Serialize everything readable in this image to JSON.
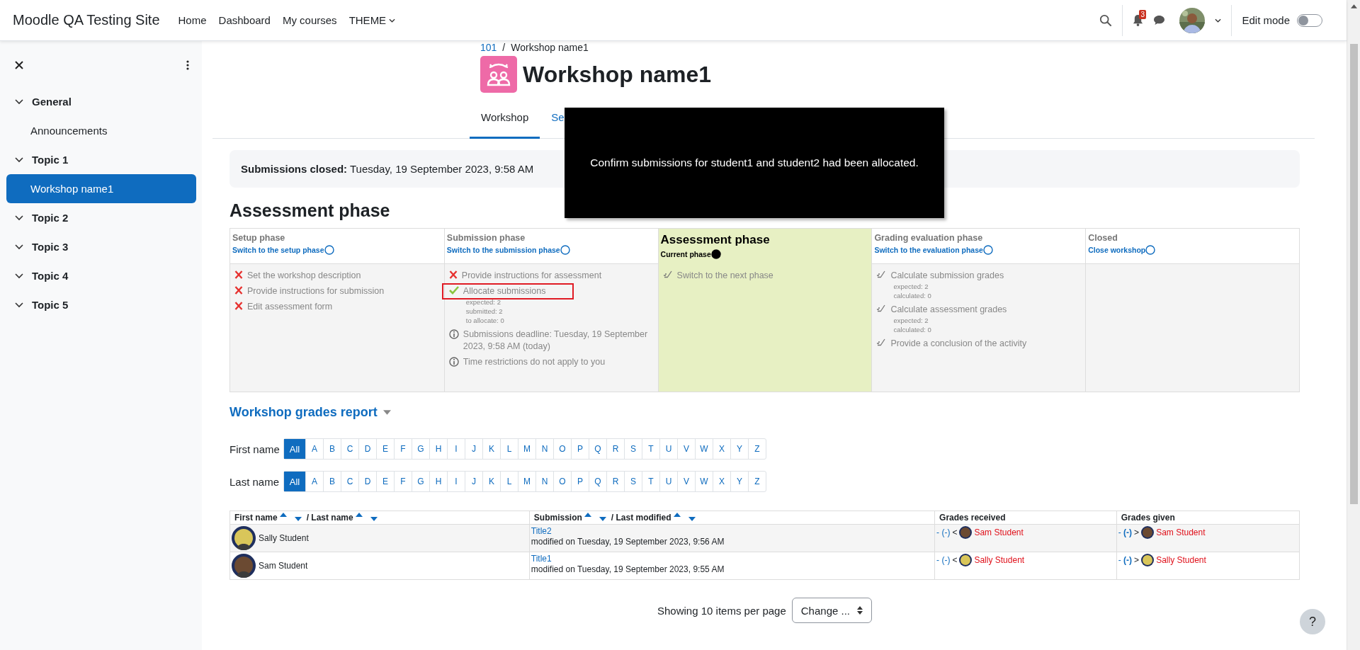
{
  "header": {
    "site_name": "Moodle QA Testing Site",
    "nav": [
      {
        "label": "Home",
        "menu": false
      },
      {
        "label": "Dashboard",
        "menu": false
      },
      {
        "label": "My courses",
        "menu": false
      },
      {
        "label": "THEME",
        "menu": true
      }
    ],
    "notification_count": "3",
    "edit_mode": {
      "label": "Edit mode",
      "on": false
    }
  },
  "sidebar": {
    "items": [
      {
        "label": "General",
        "expanded": true,
        "children": [
          {
            "label": "Announcements",
            "selected": false
          }
        ]
      },
      {
        "label": "Topic 1",
        "expanded": true,
        "children": [
          {
            "label": "Workshop name1",
            "selected": true
          }
        ]
      },
      {
        "label": "Topic 2",
        "expanded": true
      },
      {
        "label": "Topic 3",
        "expanded": true
      },
      {
        "label": "Topic 4",
        "expanded": true
      },
      {
        "label": "Topic 5",
        "expanded": true
      }
    ]
  },
  "breadcrumb": {
    "items": [
      "101",
      "Workshop name1"
    ],
    "separator": "/"
  },
  "title": "Workshop name1",
  "tabs": [
    {
      "label": "Workshop",
      "selected": true
    },
    {
      "label": "Se",
      "selected": false
    }
  ],
  "overlay": {
    "text": "Confirm submissions for student1 and student2 had been allocated."
  },
  "notice": "**Submissions closed:** Tuesday, 19 September 2023, 9:58 AM",
  "phase_heading": "Assessment phase",
  "phases": [
    {
      "name": "Setup phase",
      "link": "Switch to the setup phase",
      "current": false,
      "tasks": [
        {
          "kind": "fail",
          "label": "Set the workshop description"
        },
        {
          "kind": "fail",
          "label": "Provide instructions for submission"
        },
        {
          "kind": "fail",
          "label": "Edit assessment form"
        }
      ]
    },
    {
      "name": "Submission phase",
      "link": "Switch to the submission phase",
      "current": false,
      "tasks": [
        {
          "kind": "fail",
          "label": "Provide instructions for assessment"
        },
        {
          "kind": "done",
          "label": "Allocate submissions",
          "details": [
            "expected: 2",
            "submitted: 2",
            "to allocate: 0"
          ],
          "highlighted": true
        },
        {
          "kind": "info",
          "label": "Submissions deadline: Tuesday, 19 September 2023, 9:58 AM (today)"
        },
        {
          "kind": "info",
          "label": "Time restrictions do not apply to you"
        }
      ]
    },
    {
      "name": "Assessment phase",
      "link": "Current phase",
      "current": true,
      "tasks": [
        {
          "kind": "todo",
          "label": "Switch to the next phase"
        }
      ]
    },
    {
      "name": "Grading evaluation phase",
      "link": "Switch to the evaluation phase",
      "current": false,
      "tasks": [
        {
          "kind": "todo",
          "label": "Calculate submission grades",
          "details": [
            "expected: 2",
            "calculated: 0"
          ]
        },
        {
          "kind": "todo",
          "label": "Calculate assessment grades",
          "details": [
            "expected: 2",
            "calculated: 0"
          ]
        },
        {
          "kind": "todo",
          "label": "Provide a conclusion of the activity"
        }
      ]
    },
    {
      "name": "Closed",
      "link": "Close workshop",
      "current": false
    }
  ],
  "grades_report": {
    "title": "Workshop grades report",
    "filters": [
      {
        "label": "First name",
        "letters": [
          {
            "label": "All",
            "selected": true
          },
          {
            "label": "A",
            "selected": false
          },
          {
            "label": "B",
            "selected": false
          },
          {
            "label": "C",
            "selected": false
          },
          {
            "label": "D",
            "selected": false
          },
          {
            "label": "E",
            "selected": false
          },
          {
            "label": "F",
            "selected": false
          },
          {
            "label": "G",
            "selected": false
          },
          {
            "label": "H",
            "selected": false
          },
          {
            "label": "I",
            "selected": false
          },
          {
            "label": "J",
            "selected": false
          },
          {
            "label": "K",
            "selected": false
          },
          {
            "label": "L",
            "selected": false
          },
          {
            "label": "M",
            "selected": false
          },
          {
            "label": "N",
            "selected": false
          },
          {
            "label": "O",
            "selected": false
          },
          {
            "label": "P",
            "selected": false
          },
          {
            "label": "Q",
            "selected": false
          },
          {
            "label": "R",
            "selected": false
          },
          {
            "label": "S",
            "selected": false
          },
          {
            "label": "T",
            "selected": false
          },
          {
            "label": "U",
            "selected": false
          },
          {
            "label": "V",
            "selected": false
          },
          {
            "label": "W",
            "selected": false
          },
          {
            "label": "X",
            "selected": false
          },
          {
            "label": "Y",
            "selected": false
          },
          {
            "label": "Z",
            "selected": false
          }
        ]
      },
      {
        "label": "Last name",
        "letters": [
          {
            "label": "All",
            "selected": true
          },
          {
            "label": "A",
            "selected": false
          },
          {
            "label": "B",
            "selected": false
          },
          {
            "label": "C",
            "selected": false
          },
          {
            "label": "D",
            "selected": false
          },
          {
            "label": "E",
            "selected": false
          },
          {
            "label": "F",
            "selected": false
          },
          {
            "label": "G",
            "selected": false
          },
          {
            "label": "H",
            "selected": false
          },
          {
            "label": "I",
            "selected": false
          },
          {
            "label": "J",
            "selected": false
          },
          {
            "label": "K",
            "selected": false
          },
          {
            "label": "L",
            "selected": false
          },
          {
            "label": "M",
            "selected": false
          },
          {
            "label": "N",
            "selected": false
          },
          {
            "label": "O",
            "selected": false
          },
          {
            "label": "P",
            "selected": false
          },
          {
            "label": "Q",
            "selected": false
          },
          {
            "label": "R",
            "selected": false
          },
          {
            "label": "S",
            "selected": false
          },
          {
            "label": "T",
            "selected": false
          },
          {
            "label": "U",
            "selected": false
          },
          {
            "label": "V",
            "selected": false
          },
          {
            "label": "W",
            "selected": false
          },
          {
            "label": "X",
            "selected": false
          },
          {
            "label": "Y",
            "selected": false
          },
          {
            "label": "Z",
            "selected": false
          }
        ]
      }
    ],
    "table": {
      "columns": [
        {
          "kind": "sort",
          "parts": [
            "First name",
            "/ Last name"
          ]
        },
        {
          "kind": "sort",
          "parts": [
            "Submission",
            "/ Last modified"
          ]
        },
        {
          "kind": "plain",
          "parts": [
            "Grades received"
          ]
        },
        {
          "kind": "plain",
          "parts": [
            "Grades given"
          ]
        }
      ],
      "rows": [
        {
          "name": "Sally Student",
          "submission": "Title2",
          "modified": "modified on Tuesday, 19 September 2023, 9:56 AM",
          "received": {
            "grade": "- (-)",
            "arrow": "<",
            "name": "Sam Student"
          },
          "given": {
            "grade": "- (-)",
            "arrow": ">",
            "name": "Sam Student"
          }
        },
        {
          "name": "Sam Student",
          "submission": "Title1",
          "modified": "modified on Tuesday, 19 September 2023, 9:55 AM",
          "received": {
            "grade": "- (-)",
            "arrow": "<",
            "name": "Sally Student"
          },
          "given": {
            "grade": "- (-)",
            "arrow": ">",
            "name": "Sally Student"
          }
        }
      ]
    },
    "paging": {
      "label": "Showing 10 items per page",
      "select": "Change ..."
    }
  },
  "help": "?"
}
